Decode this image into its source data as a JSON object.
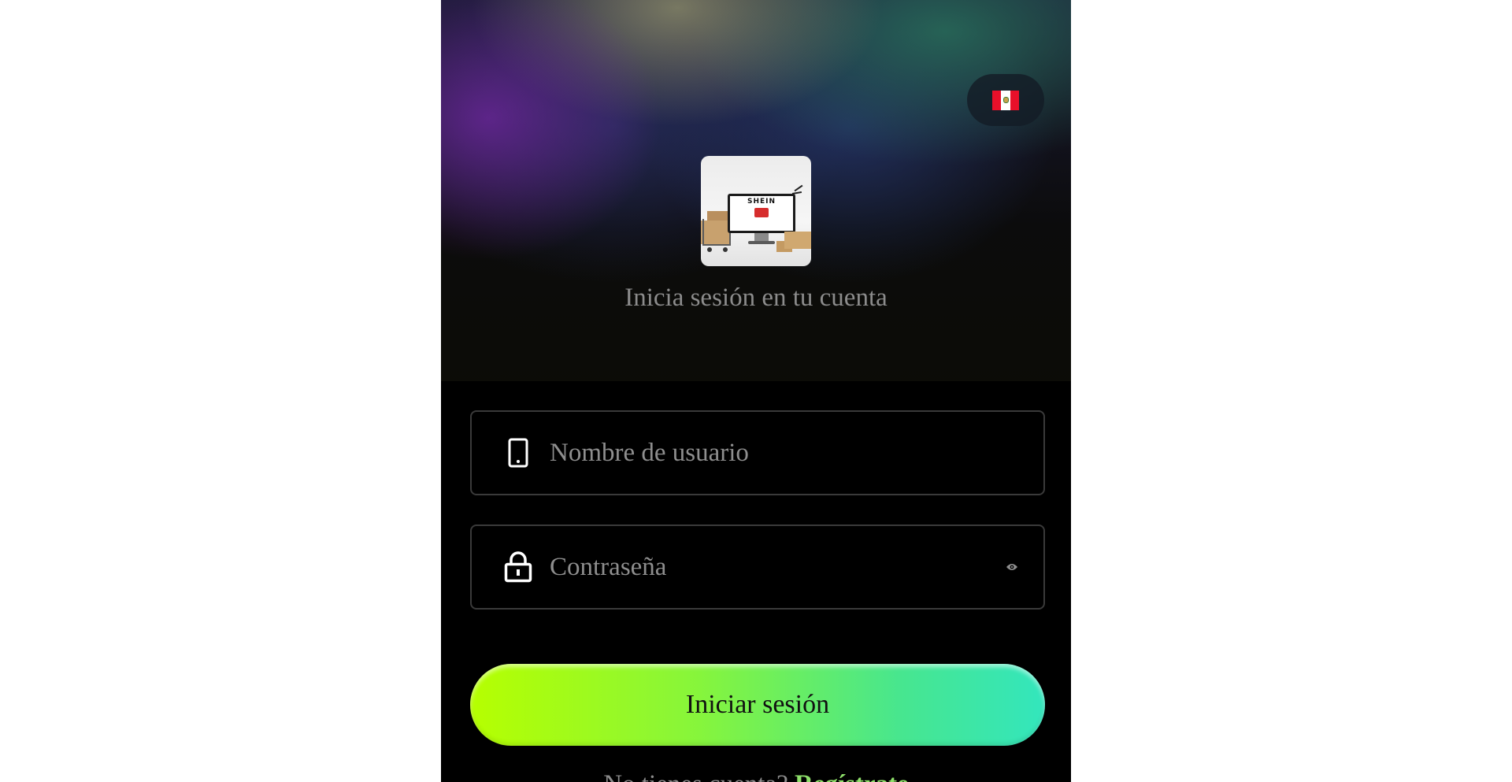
{
  "header": {
    "language_flag": "peru-flag-icon"
  },
  "branding": {
    "logo_text": "SHEIN",
    "subtitle": "Inicia sesión en tu cuenta"
  },
  "form": {
    "username": {
      "placeholder": "Nombre de usuario",
      "value": "",
      "icon": "phone-icon"
    },
    "password": {
      "placeholder": "Contraseña",
      "value": "",
      "icon": "lock-icon",
      "toggle_icon": "eye-icon"
    },
    "submit_label": "Iniciar sesión"
  },
  "footer": {
    "prompt": "No tienes cuenta?",
    "register_link": "Regístrate"
  },
  "colors": {
    "accent_start": "#b6ff00",
    "accent_end": "#33e6bd",
    "background": "#000000"
  }
}
